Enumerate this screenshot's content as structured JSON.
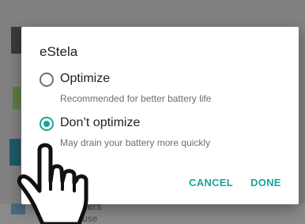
{
  "dialog": {
    "title": "eStela",
    "options": [
      {
        "label": "Optimize",
        "description": "Recommended for better battery life",
        "selected": false
      },
      {
        "label": "Don’t optimize",
        "description": "May drain your battery more quickly",
        "selected": true
      }
    ],
    "buttons": {
      "cancel": "CANCEL",
      "done": "DONE"
    }
  },
  "background": {
    "row_title": "Wallpapers",
    "row_subtitle": "battery use"
  },
  "colors": {
    "accent": "#1ba49b",
    "scrim": "#818181"
  },
  "icons": {
    "pointer": "pointing-hand-icon"
  }
}
